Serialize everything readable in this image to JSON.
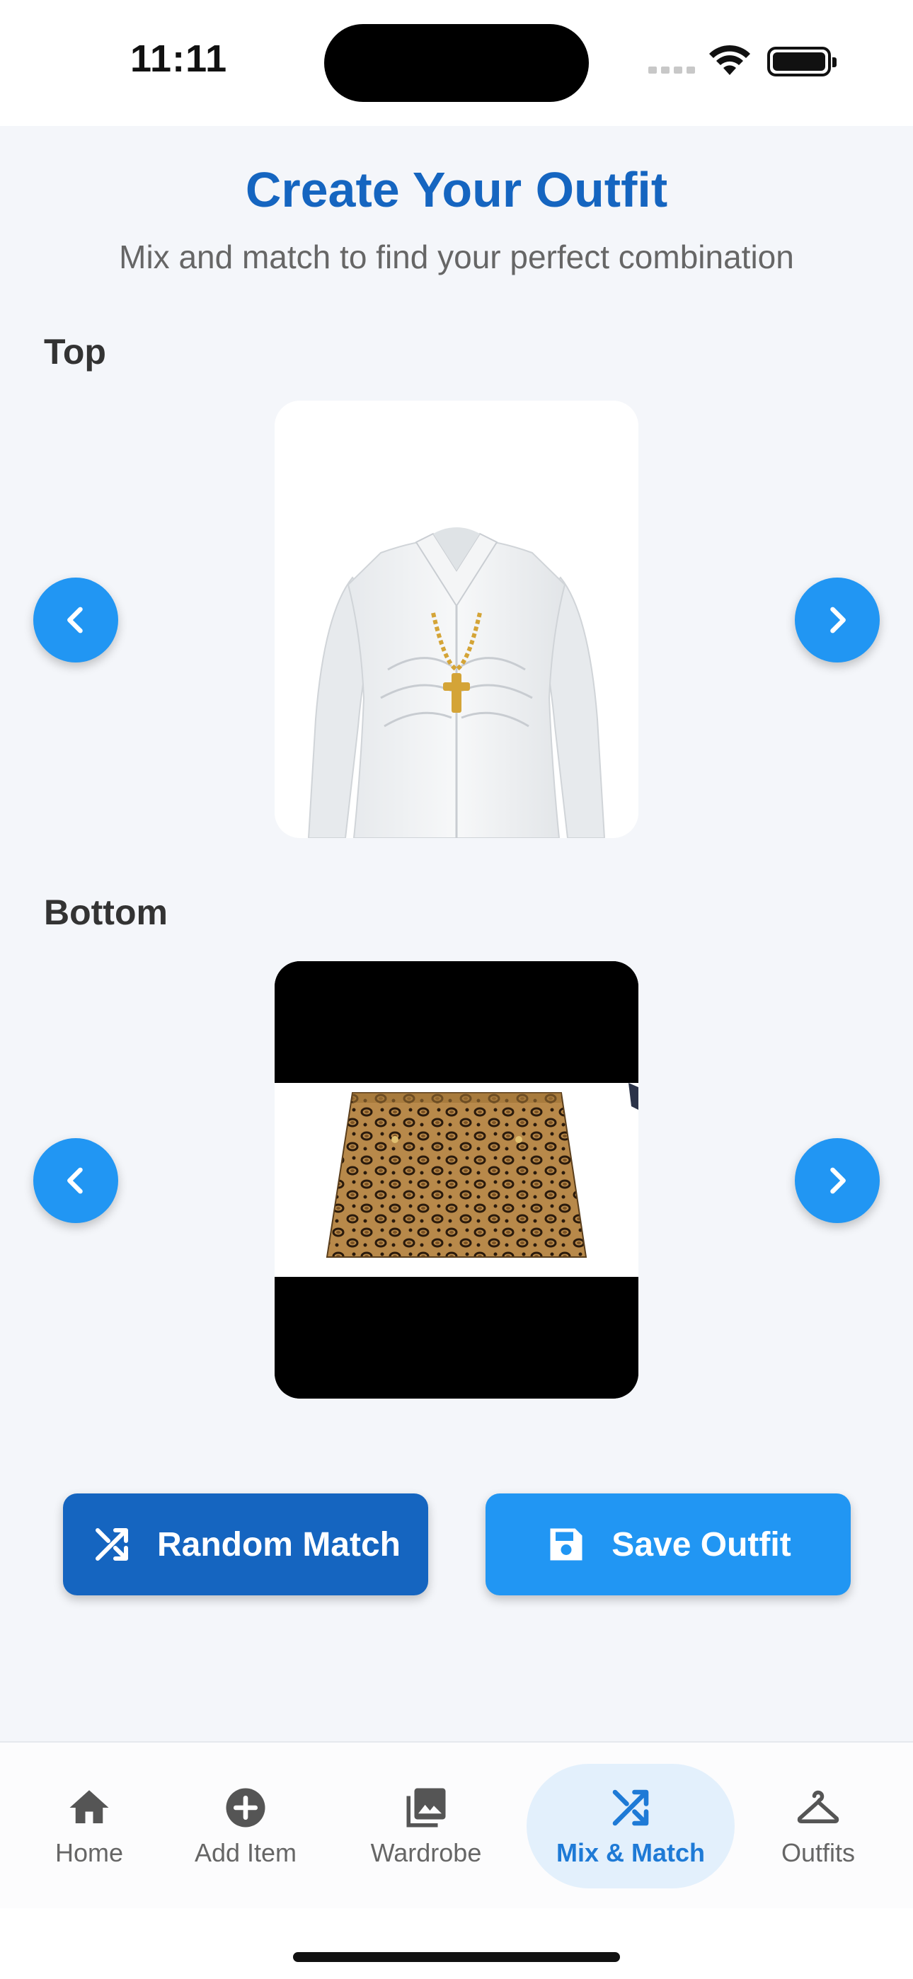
{
  "status_bar": {
    "time": "11:11"
  },
  "header": {
    "title": "Create Your Outfit",
    "subtitle": "Mix and match to find your perfect combination"
  },
  "sections": [
    {
      "label": "Top",
      "item": "white ruched button-up shirt with gold cross necklace"
    },
    {
      "label": "Bottom",
      "item": "leopard print mini skirt"
    }
  ],
  "actions": {
    "random_label": "Random Match",
    "save_label": "Save Outfit"
  },
  "nav": {
    "items": [
      {
        "label": "Home",
        "icon": "home-icon"
      },
      {
        "label": "Add Item",
        "icon": "add-circle-icon"
      },
      {
        "label": "Wardrobe",
        "icon": "photo-library-icon"
      },
      {
        "label": "Mix & Match",
        "icon": "shuffle-icon",
        "active": true
      },
      {
        "label": "Outfits",
        "icon": "hanger-icon"
      }
    ]
  },
  "colors": {
    "primary": "#1565c0",
    "accent": "#2196f3",
    "background": "#f4f6fa",
    "active_tab_bg": "#e3f0fc"
  }
}
